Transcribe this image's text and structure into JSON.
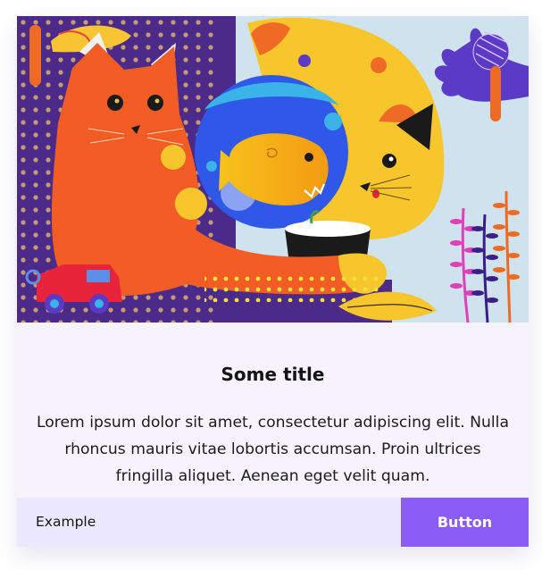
{
  "card": {
    "image_alt": "Illustration of cats and a fish in a bowl",
    "title": "Some title",
    "text": "Lorem ipsum dolor sit amet, consectetur adipiscing elit. Nulla rhoncus mauris vitae lobortis accumsan. Proin ultrices fringilla aliquet. Aenean eget velit quam.",
    "footer_label": "Example",
    "button_label": "Button"
  },
  "colors": {
    "card_background": "#f6f3ff",
    "footer_background": "#ece8fe",
    "button_background": "#8b5cf6",
    "button_text": "#ffffff"
  }
}
